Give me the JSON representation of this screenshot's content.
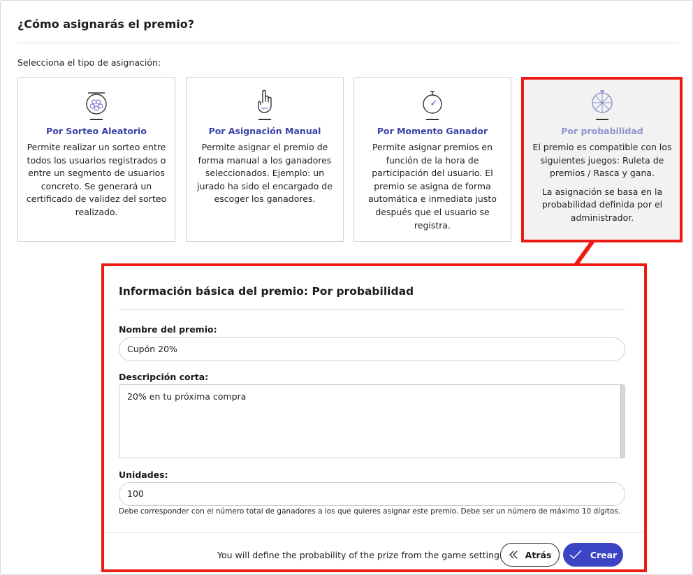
{
  "page": {
    "title": "¿Cómo asignarás el premio?",
    "select_label": "Selecciona el tipo de asignación:"
  },
  "cards": [
    {
      "icon": "lottery-ball-icon",
      "title": "Por Sorteo Aleatorio",
      "desc": [
        "Permite realizar un sorteo entre todos los usuarios registrados o entre un segmento de usuarios concreto. Se generará un certificado de validez del sorteo realizado."
      ]
    },
    {
      "icon": "hand-pointer-icon",
      "title": "Por Asignación Manual",
      "desc": [
        "Permite asignar el premio de forma manual a los ganadores seleccionados. Ejemplo: un jurado ha sido el encargado de escoger los ganadores."
      ]
    },
    {
      "icon": "stopwatch-icon",
      "title": "Por Momento Ganador",
      "desc": [
        "Permite asignar premios en función de la hora de participación del usuario. El premio se asigna de forma automática e inmediata justo después que el usuario se registra."
      ]
    },
    {
      "icon": "prize-wheel-icon",
      "title": "Por probabilidad",
      "desc": [
        "El premio es compatible con los siguientes juegos: Ruleta de premios / Rasca y gana.",
        "La asignación se basa en la probabilidad definida por el administrador."
      ],
      "selected": true
    }
  ],
  "form": {
    "title": "Información básica del premio: Por probabilidad",
    "name_label": "Nombre del premio:",
    "name_value": "Cupón 20%",
    "desc_label": "Descripción corta:",
    "desc_value": "20% en tu próxima compra",
    "units_label": "Unidades:",
    "units_value": "100",
    "units_help": "Debe corresponder con el número total de ganadores a los que quieres asignar este premio. Debe ser un número de máximo 10 dígitos.",
    "footer_note": "You will define the probability of the prize from the game settings",
    "back_label": "Atrás",
    "create_label": "Crear"
  },
  "colors": {
    "accent": "#3c44c6",
    "card_title": "#3a43a6",
    "card_title_selected": "#8e93cf",
    "highlight": "#ee1b13"
  }
}
